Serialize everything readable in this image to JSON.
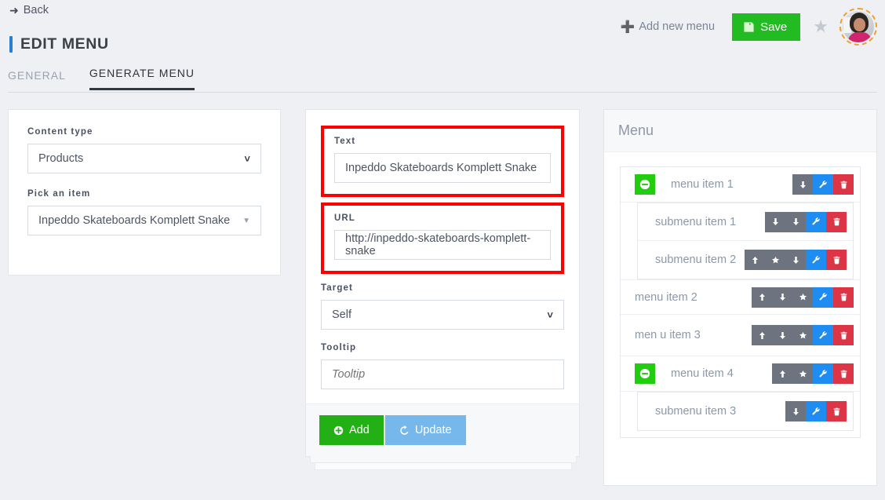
{
  "header": {
    "back_label": "Back",
    "back_icon": "arrow-left-icon",
    "page_title": "EDIT MENU",
    "add_new_menu_label": "Add new menu",
    "add_icon": "plus-icon",
    "save_label": "Save",
    "save_icon": "floppy-disk-icon",
    "favorite_icon": "star-icon",
    "avatar_icon": "user-avatar",
    "accent_color": "#2b7dd1",
    "save_color": "#22bb22"
  },
  "tabs": [
    {
      "label": "GENERAL",
      "active": false
    },
    {
      "label": "GENERATE MENU",
      "active": true
    }
  ],
  "left_panel": {
    "content_type": {
      "label": "Content type",
      "value": "Products"
    },
    "pick_item": {
      "label": "Pick an item",
      "value": "Inpeddo Skateboards Komplett Snake"
    }
  },
  "center_panel": {
    "text_field": {
      "label": "Text",
      "value": "Inpeddo Skateboards Komplett Snake",
      "highlighted": true
    },
    "url_field": {
      "label": "URL",
      "value": "http://inpeddo-skateboards-komplett-snake",
      "highlighted": true
    },
    "target_field": {
      "label": "Target",
      "value": "Self"
    },
    "tooltip_field": {
      "label": "Tooltip",
      "value": "",
      "placeholder": "Tooltip"
    },
    "add_button": {
      "label": "Add",
      "icon": "plus-circle-icon",
      "color": "#22b014"
    },
    "update_button": {
      "label": "Update",
      "icon": "refresh-icon",
      "color": "#77b8ec"
    },
    "highlight_color": "#ff0000"
  },
  "right_panel": {
    "title": "Menu",
    "items": [
      {
        "label": "menu item 1",
        "level": 0,
        "collapse_icon": "minus-circle-icon",
        "has_collapse": true,
        "actions": [
          "down-arrow-icon",
          "wrench-icon",
          "trash-icon"
        ]
      },
      {
        "label": "submenu item 1",
        "level": 1,
        "has_collapse": false,
        "actions": [
          "down-arrow-icon",
          "down-arrow-icon",
          "wrench-icon",
          "trash-icon"
        ]
      },
      {
        "label": "submenu item 2",
        "level": 1,
        "has_collapse": false,
        "actions": [
          "up-arrow-icon",
          "star-icon",
          "down-arrow-icon",
          "wrench-icon",
          "trash-icon"
        ]
      },
      {
        "label": "menu item 2",
        "level": 0,
        "has_collapse": false,
        "actions": [
          "up-arrow-icon",
          "down-arrow-icon",
          "star-icon",
          "wrench-icon",
          "trash-icon"
        ]
      },
      {
        "label": "men u item 3",
        "level": 0,
        "has_collapse": false,
        "actions": [
          "up-arrow-icon",
          "down-arrow-icon",
          "star-icon",
          "wrench-icon",
          "trash-icon"
        ]
      },
      {
        "label": "menu item 4",
        "level": 0,
        "collapse_icon": "minus-circle-icon",
        "has_collapse": true,
        "actions": [
          "up-arrow-icon",
          "star-icon",
          "wrench-icon",
          "trash-icon"
        ]
      },
      {
        "label": "submenu item 3",
        "level": 1,
        "has_collapse": false,
        "actions": [
          "down-arrow-icon",
          "wrench-icon",
          "trash-icon"
        ]
      }
    ],
    "button_colors": {
      "move": "#6d7480",
      "edit": "#1e8cf0",
      "delete": "#dc3545",
      "collapse": "#22cc11"
    }
  }
}
